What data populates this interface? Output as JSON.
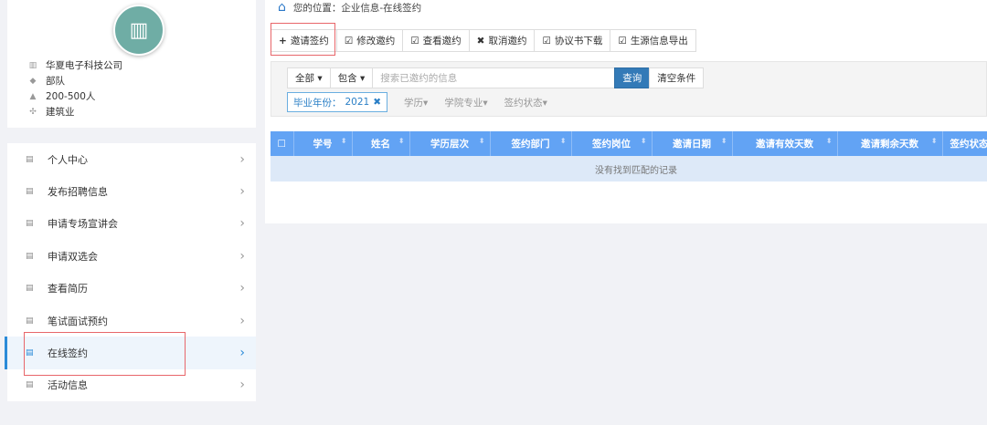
{
  "company": {
    "name": "华夏电子科技公司",
    "type": "部队",
    "size": "200-500人",
    "industry": "建筑业"
  },
  "menu": [
    {
      "label": "个人中心"
    },
    {
      "label": "发布招聘信息"
    },
    {
      "label": "申请专场宣讲会"
    },
    {
      "label": "申请双选会"
    },
    {
      "label": "查看简历"
    },
    {
      "label": "笔试面试预约"
    },
    {
      "label": "在线签约",
      "active": true
    },
    {
      "label": "活动信息"
    }
  ],
  "breadcrumb": {
    "prefix": "您的位置：",
    "path": "企业信息-在线签约"
  },
  "toolbar": [
    "邀请签约",
    "修改邀约",
    "查看邀约",
    "取消邀约",
    "协议书下载",
    "生源信息导出"
  ],
  "filter": {
    "scope": "全部",
    "match": "包含",
    "search_placeholder": "搜索已邀约的信息",
    "query": "查询",
    "clear": "清空条件",
    "tag_label": "毕业年份：",
    "tag_value": "2021",
    "dropdowns": [
      "学历",
      "学院专业",
      "签约状态"
    ]
  },
  "table": {
    "headers": [
      "学号",
      "姓名",
      "学历层次",
      "签约部门",
      "签约岗位",
      "邀请日期",
      "邀请有效天数",
      "邀请剩余天数",
      "签约状态"
    ],
    "empty": "没有找到匹配的记录"
  },
  "colors": {
    "accent": "#337ab7",
    "header": "#62a3f4",
    "highlight": "#e8666a"
  }
}
